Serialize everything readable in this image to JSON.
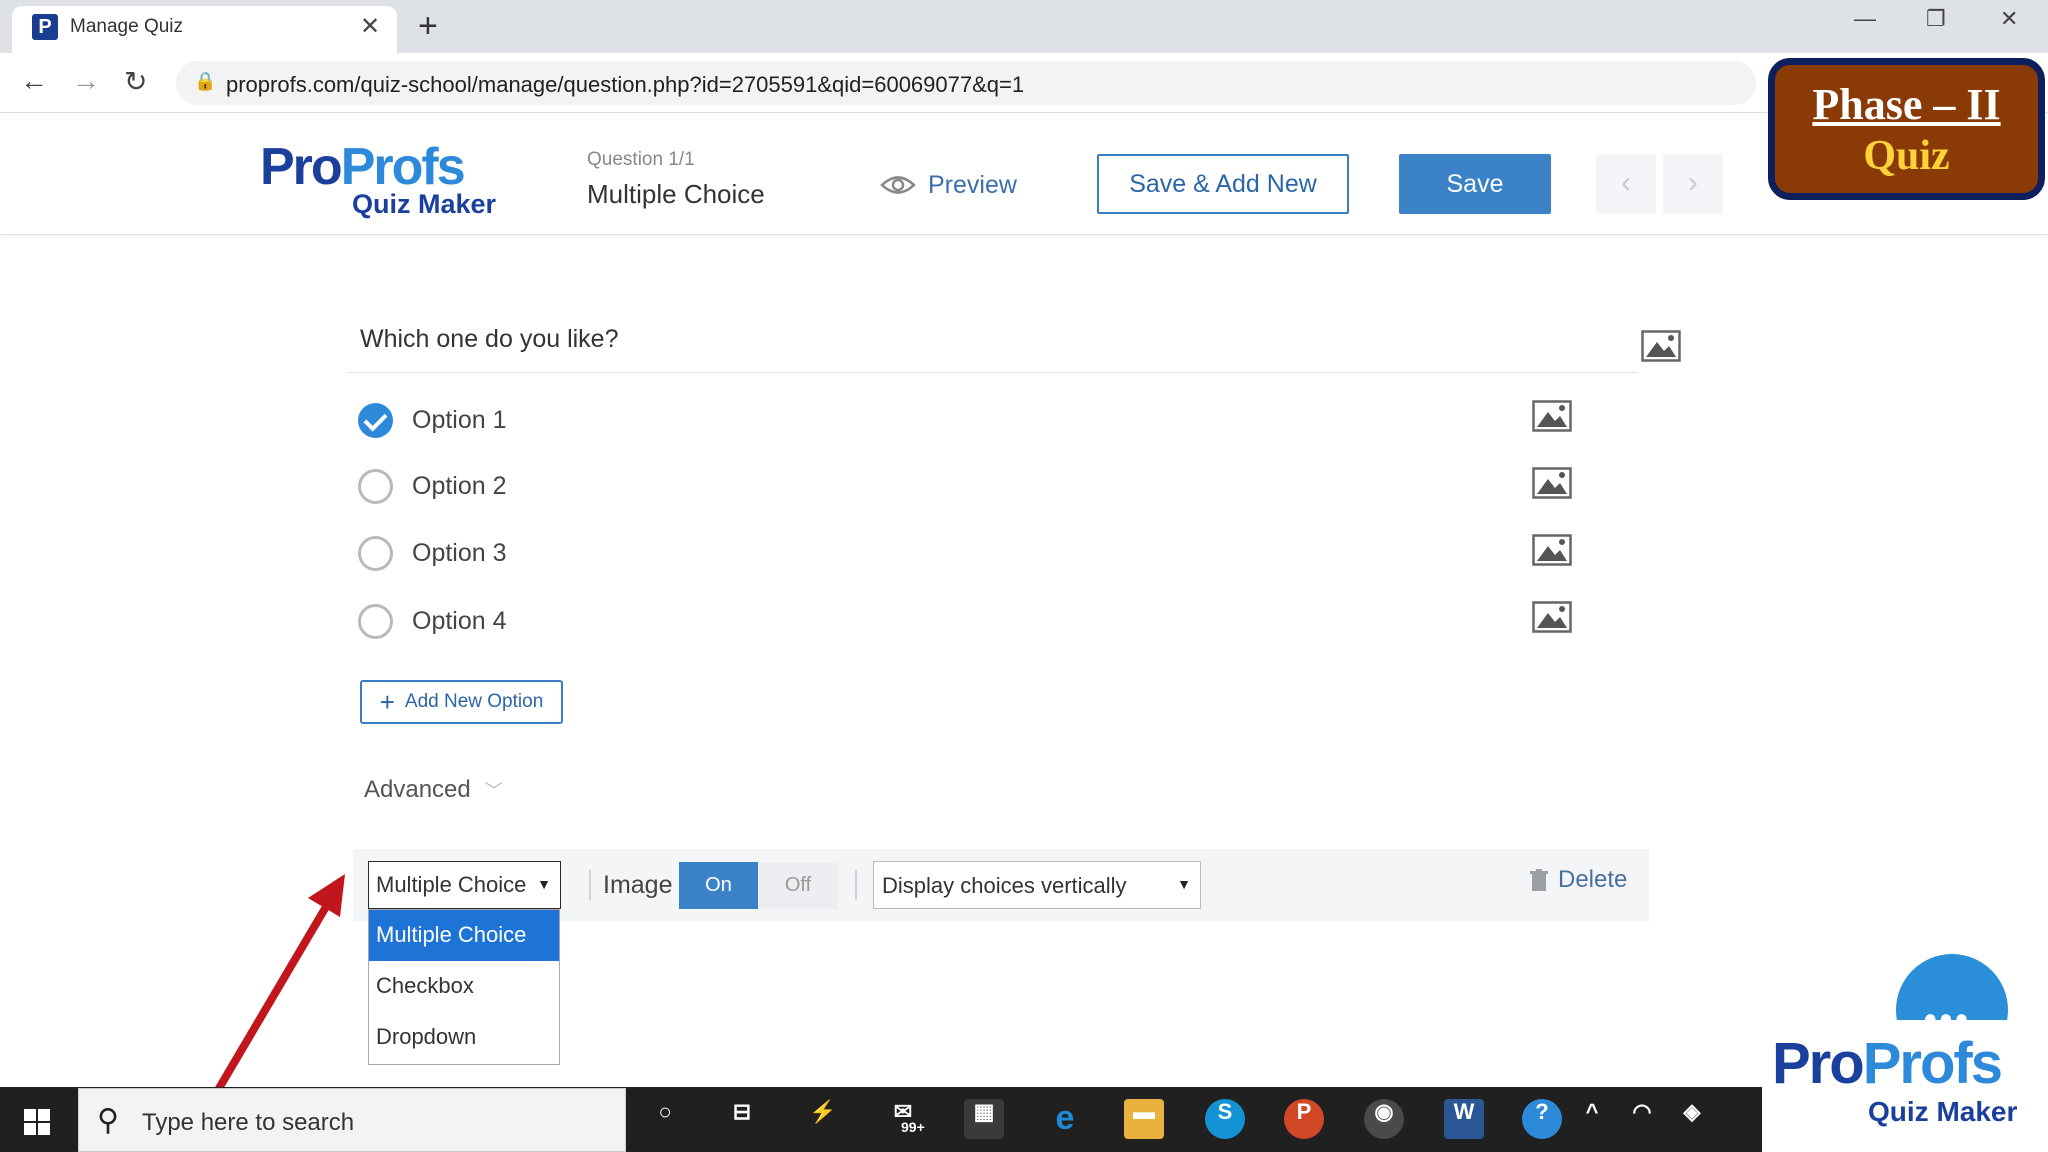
{
  "browser": {
    "tab_title": "Manage Quiz",
    "tab_close": "✕",
    "new_tab": "+",
    "url": "proprofs.com/quiz-school/manage/question.php?id=2705591&qid=60069077&q=1",
    "window_controls": [
      "minimize-icon",
      "restore-icon",
      "close-icon"
    ]
  },
  "header": {
    "logo_pro_part1": "Pro",
    "logo_pro_part2": "Profs",
    "logo_sub": "Quiz Maker",
    "question_counter": "Question 1/1",
    "question_type": "Multiple Choice",
    "preview_label": "Preview",
    "save_add_label": "Save & Add New",
    "save_label": "Save",
    "prev_icon": "‹",
    "next_icon": "›"
  },
  "badge": {
    "line1": "Phase – II",
    "line2": "Quiz"
  },
  "question": {
    "text": "Which one do you like?",
    "options": [
      {
        "label": "Option 1",
        "checked": true
      },
      {
        "label": "Option 2",
        "checked": false
      },
      {
        "label": "Option 3",
        "checked": false
      },
      {
        "label": "Option 4",
        "checked": false
      }
    ],
    "add_option_label": "Add New Option",
    "advanced_label": "Advanced"
  },
  "toolbar": {
    "question_type_value": "Multiple Choice",
    "image_label": "Image",
    "toggle_on": "On",
    "toggle_off": "Off",
    "display_value": "Display choices vertically",
    "delete_label": "Delete",
    "dropdown_options": [
      "Multiple Choice",
      "Checkbox",
      "Dropdown"
    ],
    "dropdown_selected": "Multiple Choice"
  },
  "taskbar": {
    "search_placeholder": "Type here to search",
    "mail_badge": "99+"
  },
  "watermark": {
    "pro_part1": "Pro",
    "pro_part2": "Profs",
    "sub": "Quiz Maker"
  },
  "colors": {
    "accent_blue": "#3b82c9",
    "dropdown_highlight": "#1e73d6",
    "badge_bg": "#8a3a05",
    "badge_border": "#0d1f5c",
    "arrow_red": "#c0161c"
  }
}
